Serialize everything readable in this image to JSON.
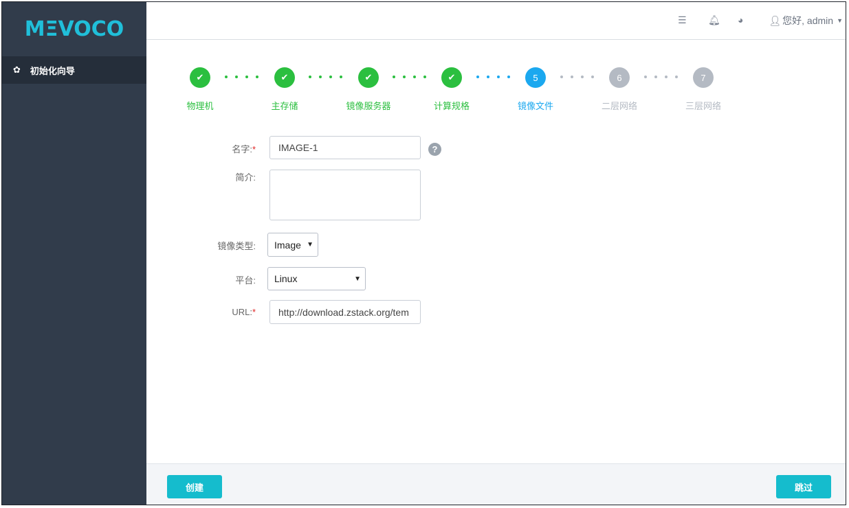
{
  "brand": {
    "logo": "MΞVOCO"
  },
  "sidebar": {
    "items": [
      {
        "icon": "gear-icon",
        "label": "初始化向导"
      }
    ]
  },
  "header": {
    "icons": [
      "list-icon",
      "bell-icon",
      "globe-icon",
      "user-icon"
    ],
    "user_label": "您好, admin"
  },
  "wizard": {
    "steps": [
      {
        "number": "1",
        "label": "物理机",
        "status": "done"
      },
      {
        "number": "2",
        "label": "主存储",
        "status": "done"
      },
      {
        "number": "3",
        "label": "镜像服务器",
        "status": "done"
      },
      {
        "number": "4",
        "label": "计算规格",
        "status": "done"
      },
      {
        "number": "5",
        "label": "镜像文件",
        "status": "active"
      },
      {
        "number": "6",
        "label": "二层网络",
        "status": "todo"
      },
      {
        "number": "7",
        "label": "三层网络",
        "status": "todo"
      }
    ],
    "colors": {
      "done": "#2bbf3f",
      "active": "#1ba8ef",
      "todo": "#b4bac3"
    }
  },
  "form": {
    "name": {
      "label": "名字:",
      "required": "*",
      "value": "IMAGE-1"
    },
    "description": {
      "label": "简介:",
      "value": ""
    },
    "image_type": {
      "label": "镜像类型:",
      "value": "Image"
    },
    "platform": {
      "label": "平台:",
      "value": "Linux"
    },
    "url": {
      "label": "URL:",
      "required": "*",
      "value": "http://download.zstack.org/tem"
    }
  },
  "footer": {
    "create_label": "创建",
    "skip_label": "跳过"
  }
}
